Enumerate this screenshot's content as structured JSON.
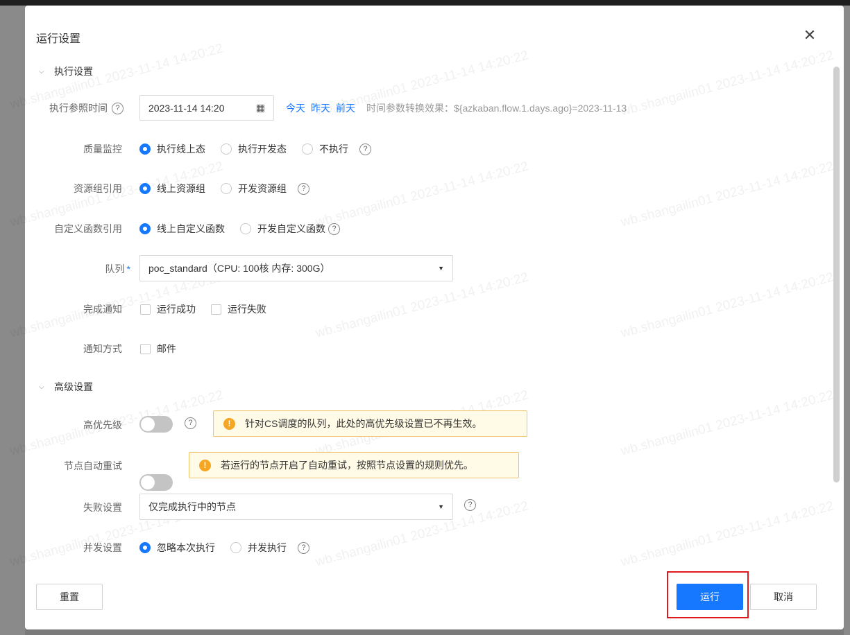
{
  "dialog": {
    "title": "运行设置"
  },
  "sections": {
    "exec": "执行设置",
    "advanced": "高级设置"
  },
  "exec_time": {
    "label": "执行参照时间",
    "value": "2023-11-14 14:20",
    "links": [
      "今天",
      "昨天",
      "前天"
    ],
    "hint": "时间参数转换效果：${azkaban.flow.1.days.ago}=2023-11-13"
  },
  "quality": {
    "label": "质量监控",
    "options": [
      "执行线上态",
      "执行开发态",
      "不执行"
    ],
    "selected": 0
  },
  "resource": {
    "label": "资源组引用",
    "options": [
      "线上资源组",
      "开发资源组"
    ],
    "selected": 0
  },
  "udf": {
    "label": "自定义函数引用",
    "options": [
      "线上自定义函数",
      "开发自定义函数"
    ],
    "selected": 0
  },
  "queue": {
    "label": "队列",
    "required_mark": "*",
    "value": "poc_standard（CPU: 100核 内存: 300G）"
  },
  "notify": {
    "label": "完成通知",
    "options": [
      "运行成功",
      "运行失败"
    ]
  },
  "notify_method": {
    "label": "通知方式",
    "options": [
      "邮件"
    ]
  },
  "priority": {
    "label": "高优先级",
    "alert": "针对CS调度的队列，此处的高优先级设置已不再生效。"
  },
  "auto_retry": {
    "label": "节点自动重试",
    "alert": "若运行的节点开启了自动重试，按照节点设置的规则优先。"
  },
  "failure": {
    "label": "失败设置",
    "value": "仅完成执行中的节点"
  },
  "concurrency": {
    "label": "并发设置",
    "options": [
      "忽略本次执行",
      "并发执行"
    ],
    "selected": 0
  },
  "buttons": {
    "reset": "重置",
    "run": "运行",
    "cancel": "取消"
  },
  "watermark": "wb.shangailin01 2023-11-14 14:20:22",
  "colors": {
    "primary": "#1677ff",
    "warning": "#f5a623",
    "highlight": "#e0191f"
  }
}
